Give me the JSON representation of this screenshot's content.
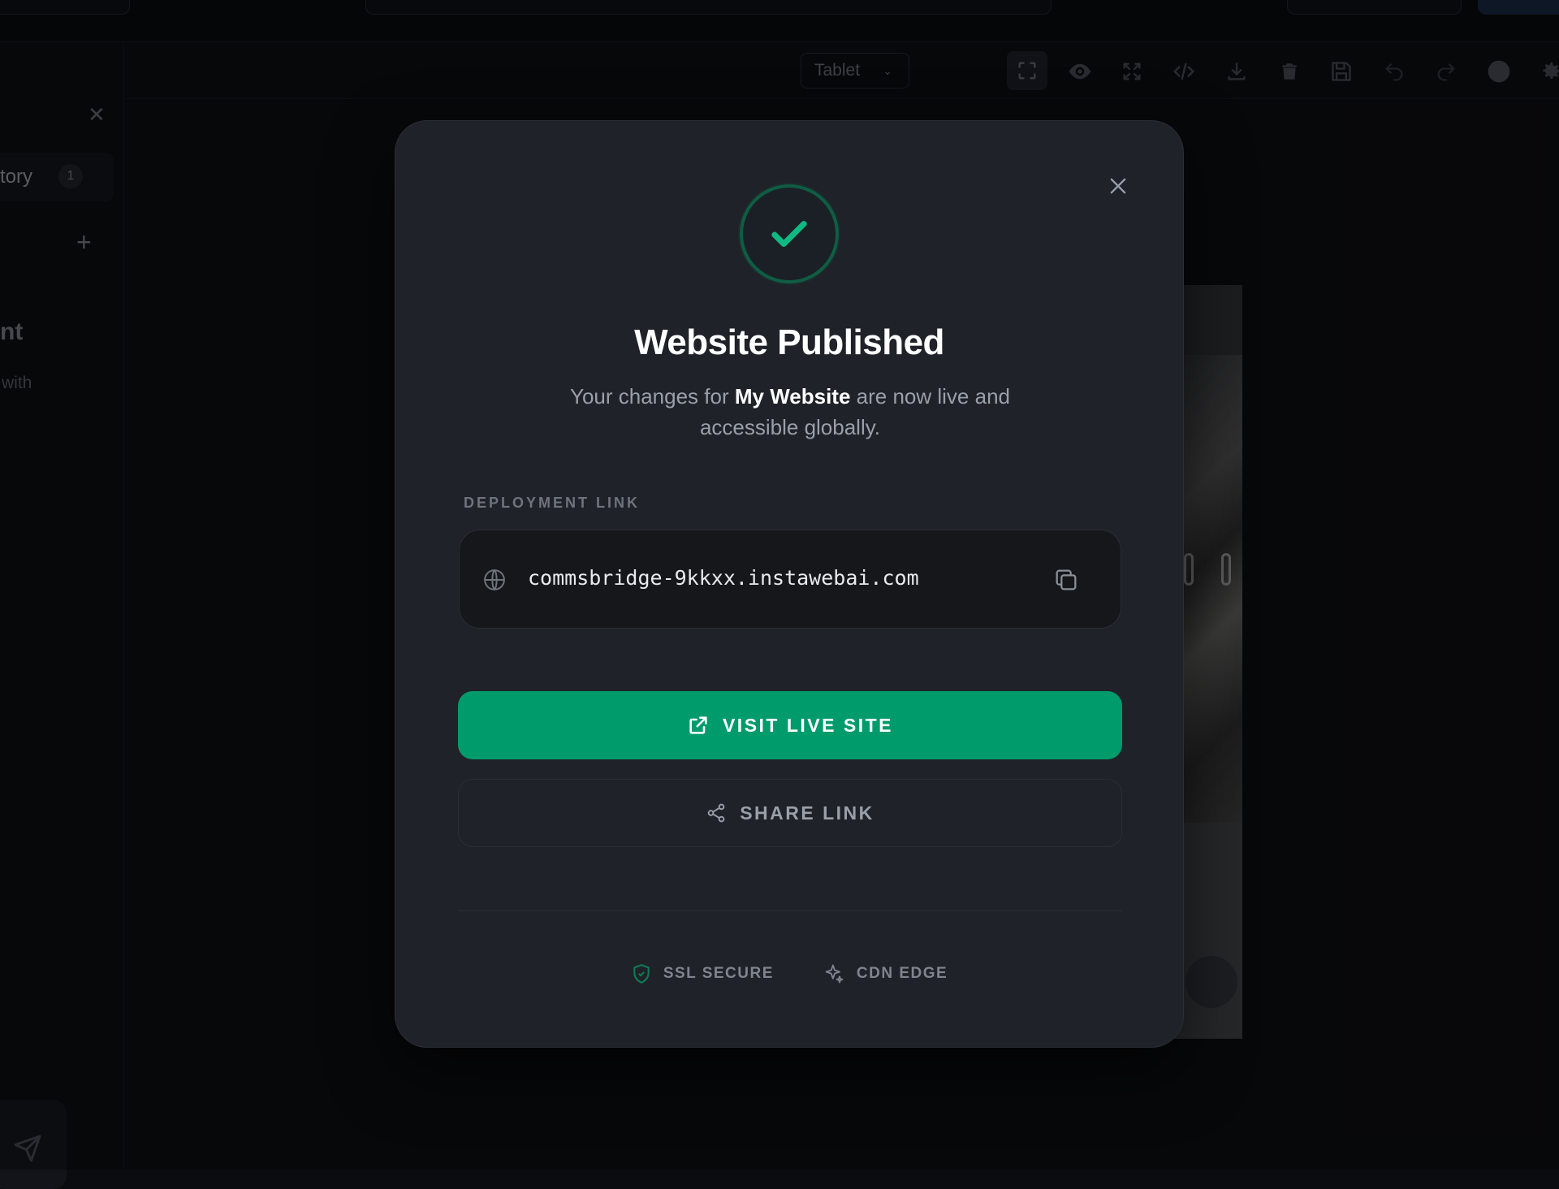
{
  "sidebar": {
    "history_label": "tory",
    "history_count": "1",
    "frag_title": "nt",
    "frag_sub": "with"
  },
  "toolbar": {
    "device": "Tablet",
    "icons": [
      "select-frame-icon",
      "eye-icon",
      "fullscreen-icon",
      "code-icon",
      "download-icon",
      "trash-icon",
      "save-icon",
      "undo-icon",
      "redo-icon",
      "theme-icon",
      "settings-icon"
    ]
  },
  "modal": {
    "title": "Website Published",
    "desc_before": "Your changes for ",
    "site_name": "My Website",
    "desc_after": " are now live and accessible globally.",
    "section_label": "DEPLOYMENT LINK",
    "url": "commsbridge-9kkxx.instawebai.com",
    "visit_label": "VISIT LIVE SITE",
    "share_label": "SHARE LINK",
    "badge_ssl": "SSL SECURE",
    "badge_cdn": "CDN EDGE"
  },
  "colors": {
    "accent": "#009b6b",
    "success": "#10b981",
    "modal_bg": "#1f2228",
    "page_bg": "#0b0c0f"
  }
}
